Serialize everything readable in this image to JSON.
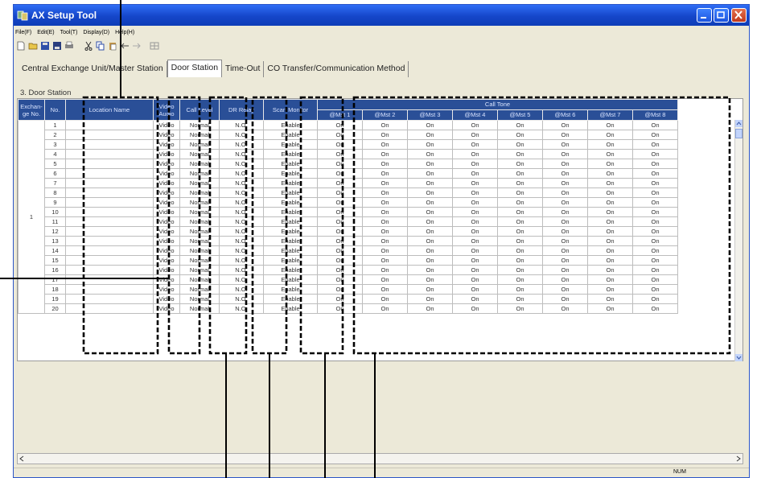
{
  "app": {
    "title": "AX Setup Tool"
  },
  "menu": [
    "File(F)",
    "Edit(E)",
    "Tool(T)",
    "Display(D)",
    "Help(H)"
  ],
  "toolbar_icons": [
    "new-icon",
    "open-icon",
    "save-icon",
    "save-as-icon",
    "print-icon",
    "cut-icon",
    "copy-icon",
    "paste-icon",
    "back-icon",
    "forward-icon",
    "grid-icon"
  ],
  "tabs": [
    "Central Exchange Unit/Master Station",
    "Door Station",
    "Time-Out",
    "CO Transfer/Communication Method"
  ],
  "active_tab": 1,
  "section_title": "3. Door Station",
  "table": {
    "headers": {
      "exchange": "Exchan-ge No.",
      "no": "No.",
      "location": "Location Name",
      "video": "Video Audio",
      "call_level": "Call Level",
      "dr_relay": "DR Relay",
      "scan": "Scan Monitor",
      "call_tone": "Call Tone",
      "masters": [
        "@Mst 1",
        "@Mst 2",
        "@Mst 3",
        "@Mst 4",
        "@Mst 5",
        "@Mst 6",
        "@Mst 7",
        "@Mst 8"
      ]
    },
    "exchange_no": "1",
    "rows": [
      {
        "no": "1",
        "location": "",
        "video": "Video",
        "call_level": "Normal",
        "dr_relay": "N.O.",
        "scan": "Enable",
        "tones": [
          "On",
          "On",
          "On",
          "On",
          "On",
          "On",
          "On",
          "On"
        ]
      },
      {
        "no": "2",
        "location": "",
        "video": "Video",
        "call_level": "Normal",
        "dr_relay": "N.O.",
        "scan": "Enable",
        "tones": [
          "On",
          "On",
          "On",
          "On",
          "On",
          "On",
          "On",
          "On"
        ]
      },
      {
        "no": "3",
        "location": "",
        "video": "Video",
        "call_level": "Normal",
        "dr_relay": "N.O.",
        "scan": "Enable",
        "tones": [
          "On",
          "On",
          "On",
          "On",
          "On",
          "On",
          "On",
          "On"
        ]
      },
      {
        "no": "4",
        "location": "",
        "video": "Video",
        "call_level": "Normal",
        "dr_relay": "N.O.",
        "scan": "Enable",
        "tones": [
          "On",
          "On",
          "On",
          "On",
          "On",
          "On",
          "On",
          "On"
        ]
      },
      {
        "no": "5",
        "location": "",
        "video": "Video",
        "call_level": "Normal",
        "dr_relay": "N.O.",
        "scan": "Enable",
        "tones": [
          "On",
          "On",
          "On",
          "On",
          "On",
          "On",
          "On",
          "On"
        ]
      },
      {
        "no": "6",
        "location": "",
        "video": "Video",
        "call_level": "Normal",
        "dr_relay": "N.O.",
        "scan": "Enable",
        "tones": [
          "On",
          "On",
          "On",
          "On",
          "On",
          "On",
          "On",
          "On"
        ]
      },
      {
        "no": "7",
        "location": "",
        "video": "Video",
        "call_level": "Normal",
        "dr_relay": "N.O.",
        "scan": "Enable",
        "tones": [
          "On",
          "On",
          "On",
          "On",
          "On",
          "On",
          "On",
          "On"
        ]
      },
      {
        "no": "8",
        "location": "",
        "video": "Video",
        "call_level": "Normal",
        "dr_relay": "N.O.",
        "scan": "Enable",
        "tones": [
          "On",
          "On",
          "On",
          "On",
          "On",
          "On",
          "On",
          "On"
        ]
      },
      {
        "no": "9",
        "location": "",
        "video": "Video",
        "call_level": "Normal",
        "dr_relay": "N.O.",
        "scan": "Enable",
        "tones": [
          "On",
          "On",
          "On",
          "On",
          "On",
          "On",
          "On",
          "On"
        ]
      },
      {
        "no": "10",
        "location": "",
        "video": "Video",
        "call_level": "Normal",
        "dr_relay": "N.O.",
        "scan": "Enable",
        "tones": [
          "On",
          "On",
          "On",
          "On",
          "On",
          "On",
          "On",
          "On"
        ]
      },
      {
        "no": "11",
        "location": "",
        "video": "Video",
        "call_level": "Normal",
        "dr_relay": "N.O.",
        "scan": "Enable",
        "tones": [
          "On",
          "On",
          "On",
          "On",
          "On",
          "On",
          "On",
          "On"
        ]
      },
      {
        "no": "12",
        "location": "",
        "video": "Video",
        "call_level": "Normal",
        "dr_relay": "N.O.",
        "scan": "Enable",
        "tones": [
          "On",
          "On",
          "On",
          "On",
          "On",
          "On",
          "On",
          "On"
        ]
      },
      {
        "no": "13",
        "location": "",
        "video": "Video",
        "call_level": "Normal",
        "dr_relay": "N.O.",
        "scan": "Enable",
        "tones": [
          "On",
          "On",
          "On",
          "On",
          "On",
          "On",
          "On",
          "On"
        ]
      },
      {
        "no": "14",
        "location": "",
        "video": "Video",
        "call_level": "Normal",
        "dr_relay": "N.O.",
        "scan": "Enable",
        "tones": [
          "On",
          "On",
          "On",
          "On",
          "On",
          "On",
          "On",
          "On"
        ]
      },
      {
        "no": "15",
        "location": "",
        "video": "Video",
        "call_level": "Normal",
        "dr_relay": "N.O.",
        "scan": "Enable",
        "tones": [
          "On",
          "On",
          "On",
          "On",
          "On",
          "On",
          "On",
          "On"
        ]
      },
      {
        "no": "16",
        "location": "",
        "video": "Video",
        "call_level": "Normal",
        "dr_relay": "N.O.",
        "scan": "Enable",
        "tones": [
          "On",
          "On",
          "On",
          "On",
          "On",
          "On",
          "On",
          "On"
        ]
      },
      {
        "no": "17",
        "location": "",
        "video": "Video",
        "call_level": "Normal",
        "dr_relay": "N.O.",
        "scan": "Enable",
        "tones": [
          "On",
          "On",
          "On",
          "On",
          "On",
          "On",
          "On",
          "On"
        ]
      },
      {
        "no": "18",
        "location": "",
        "video": "Video",
        "call_level": "Normal",
        "dr_relay": "N.O.",
        "scan": "Enable",
        "tones": [
          "On",
          "On",
          "On",
          "On",
          "On",
          "On",
          "On",
          "On"
        ]
      },
      {
        "no": "19",
        "location": "",
        "video": "Video",
        "call_level": "Normal",
        "dr_relay": "N.O.",
        "scan": "Enable",
        "tones": [
          "On",
          "On",
          "On",
          "On",
          "On",
          "On",
          "On",
          "On"
        ]
      },
      {
        "no": "20",
        "location": "",
        "video": "Video",
        "call_level": "Normal",
        "dr_relay": "N.O.",
        "scan": "Enable",
        "tones": [
          "On",
          "On",
          "On",
          "On",
          "On",
          "On",
          "On",
          "On"
        ]
      }
    ]
  },
  "status": {
    "num": "NUM"
  },
  "colors": {
    "title_bar": "#1546c9",
    "header_bg": "#2a4f97",
    "window_bg": "#ece9d8"
  }
}
